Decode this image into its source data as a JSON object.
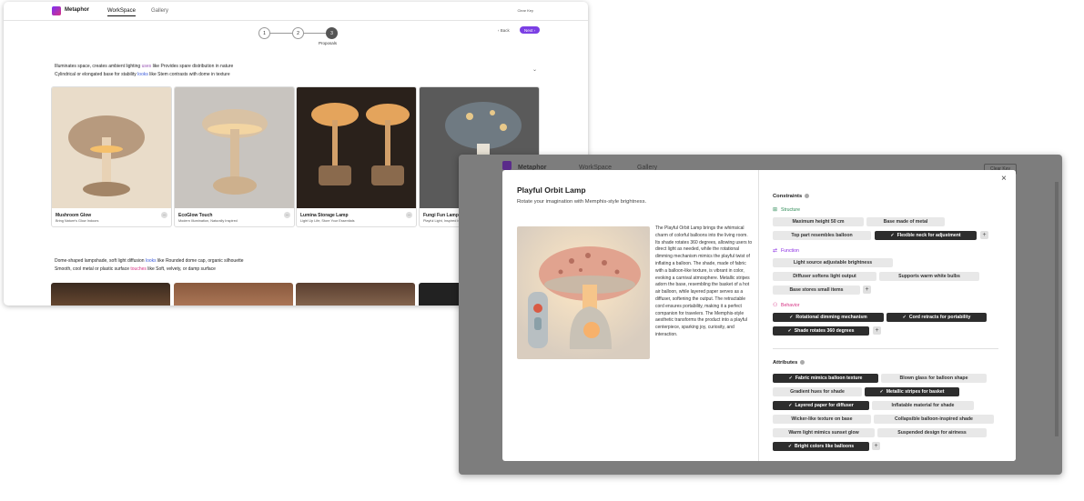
{
  "app": {
    "brand": "Metaphor",
    "tabs": [
      "WorkSpace",
      "Gallery"
    ],
    "clear_key": "Clear Key"
  },
  "stepper": {
    "steps": [
      "1",
      "2",
      "3"
    ],
    "current_label": "Proposals",
    "back": "‹ Back",
    "next": "Next ›"
  },
  "section1": {
    "line1_a": "Illuminates space, creates ambient lighting",
    "line1_b": "uses",
    "line1_c": "like Provides spare distribution in nature",
    "line2_a": "Cylindrical or elongated base for stability",
    "line2_b": "looks",
    "line2_c": "like Stem contrasts with dome in texture"
  },
  "cards": [
    {
      "title": "Mushroom Glow",
      "sub": "Bring Nature's Glow Indoors"
    },
    {
      "title": "EcoGlow Touch",
      "sub": "Modern Illumination, Naturally Inspired"
    },
    {
      "title": "Lumina Storage Lamp",
      "sub": "Light Up Life, Store Your Essentials"
    },
    {
      "title": "Fungi Fun Lamp",
      "sub": "Playful Light, Inspired by"
    }
  ],
  "section2": {
    "line1_a": "Dome-shaped lampshade, soft light diffusion",
    "line1_b": "looks",
    "line1_c": "like Rounded dome cap, organic silhouette",
    "line2_a": "Smooth, cool metal or plastic surface",
    "line2_b": "touches",
    "line2_c": "like Soft, velvety, or damp surface"
  },
  "modal": {
    "title": "Playful Orbit Lamp",
    "subtitle": "Rotate your imagination with Memphis-style brightness.",
    "description": "The Playful Orbit Lamp brings the whimsical charm of colorful balloons into the living room. Its shade rotates 360 degrees, allowing users to direct light as needed, while the rotational dimming mechanism mimics the playful twist of inflating a balloon. The shade, made of fabric with a balloon-like texture, is vibrant in color, evoking a carnival atmosphere. Metallic stripes adorn the base, resembling the basket of a hot air balloon, while layered paper serves as a diffuser, softening the output. The retractable cord ensures portability, making it a perfect companion for travelers. The Memphis-style aesthetic transforms the product into a playful centerpiece, sparking joy, curiosity, and interaction.",
    "close": "×",
    "constraints_label": "Constraints",
    "attributes_label": "Attributes",
    "structure_label": "Structure",
    "function_label": "Function",
    "behavior_label": "Behavior",
    "structure_chips": [
      "Maximum height 50 cm",
      "Base made of metal",
      "Top part resembles balloon",
      "Flexible neck for adjustment"
    ],
    "function_chips": [
      "Light source adjustable brightness",
      "Diffuser softens light output",
      "Supports warm white bulbs",
      "Base stores small items"
    ],
    "behavior_chips": [
      "Rotational dimming mechanism",
      "Cord retracts for portability",
      "Shade rotates 360 degrees"
    ],
    "attribute_chips": [
      "Fabric mimics balloon texture",
      "Blown glass for balloon shape",
      "Gradient hues for shade",
      "Metallic stripes for basket",
      "Layered paper for diffuser",
      "Inflatable material for shade",
      "Wicker-like texture on base",
      "Collapsible balloon-inspired shade",
      "Warm light mimics sunset glow",
      "Suspended design for airiness",
      "Bright colors like balloons"
    ],
    "plus": "+"
  },
  "colors": {
    "accent": "#7b3fe4",
    "structure": "#2e8b57",
    "function": "#8a2be2",
    "behavior": "#d63384",
    "chip_selected": "#2d2d2d",
    "chip_default": "#e8e8e8"
  }
}
